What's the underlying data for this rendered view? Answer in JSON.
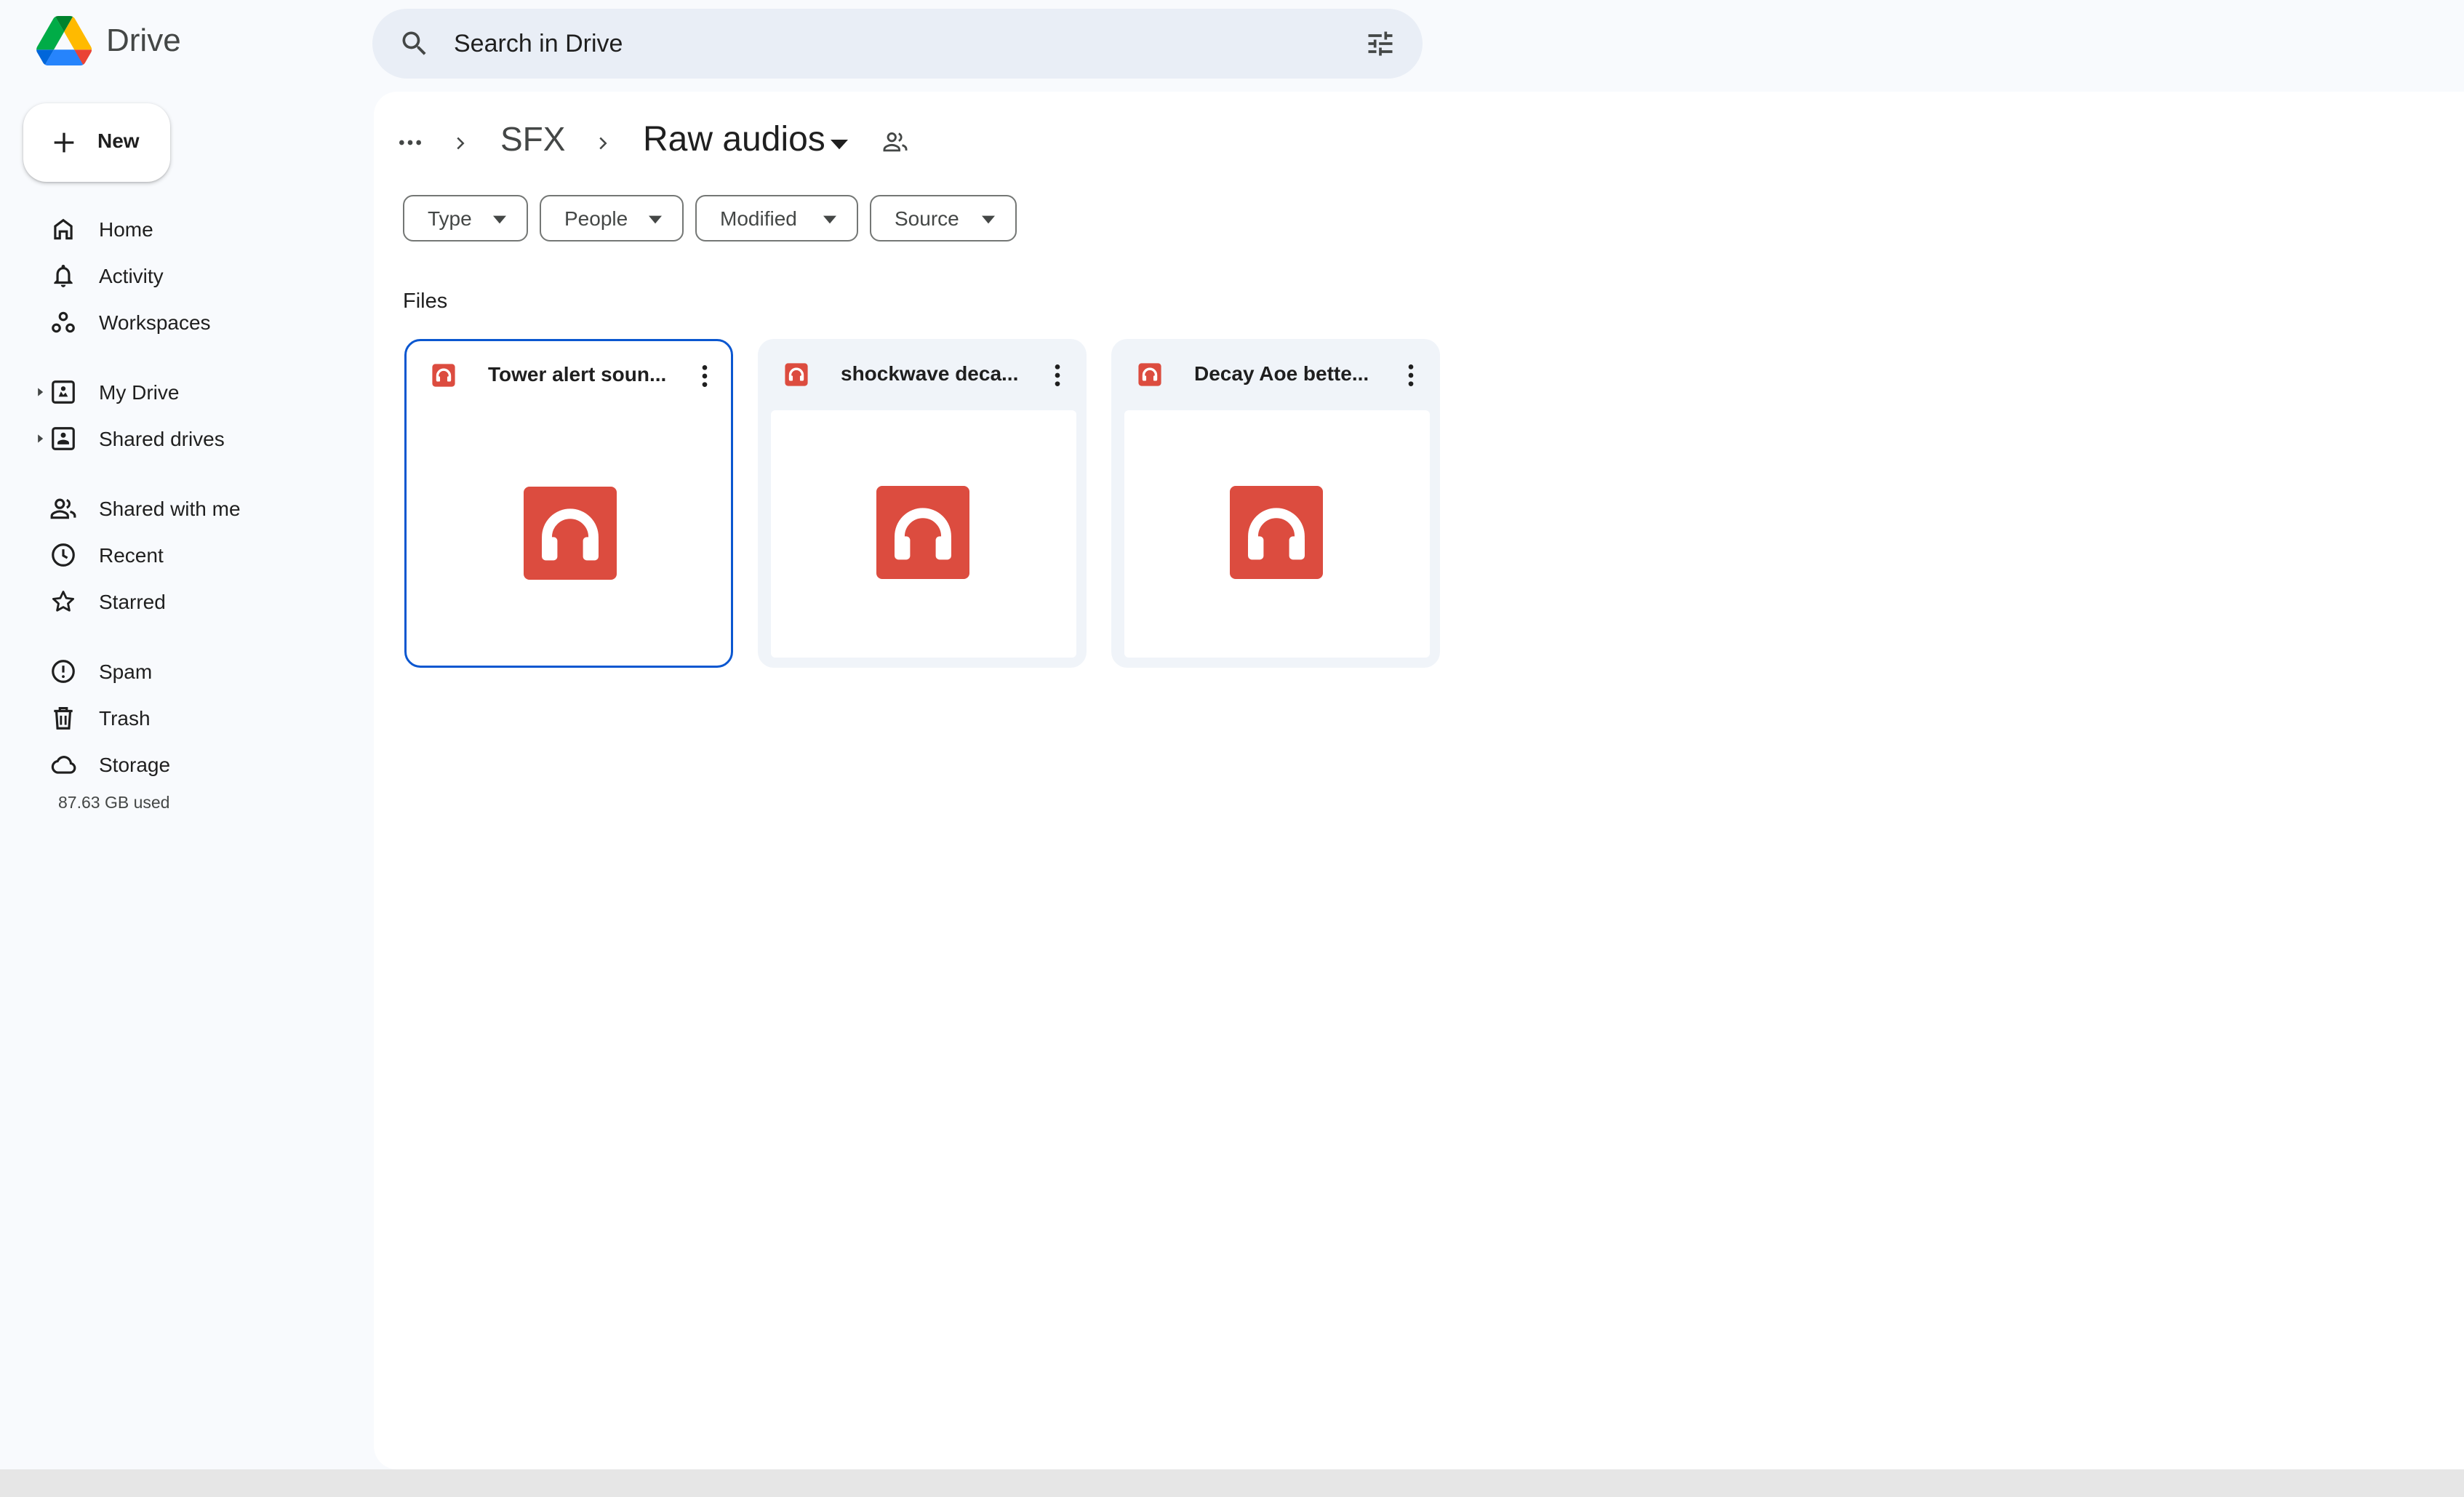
{
  "app": {
    "name": "Drive"
  },
  "search": {
    "placeholder": "Search in Drive"
  },
  "sidebar": {
    "new_label": "New",
    "items": [
      {
        "label": "Home",
        "icon": "home-icon"
      },
      {
        "label": "Activity",
        "icon": "bell-icon"
      },
      {
        "label": "Workspaces",
        "icon": "workspaces-icon"
      },
      {
        "label": "My Drive",
        "icon": "my-drive-icon"
      },
      {
        "label": "Shared drives",
        "icon": "shared-drives-icon"
      },
      {
        "label": "Shared with me",
        "icon": "people-icon"
      },
      {
        "label": "Recent",
        "icon": "clock-icon"
      },
      {
        "label": "Starred",
        "icon": "star-icon"
      },
      {
        "label": "Spam",
        "icon": "spam-icon"
      },
      {
        "label": "Trash",
        "icon": "trash-icon"
      },
      {
        "label": "Storage",
        "icon": "cloud-icon"
      }
    ],
    "storage_used": "87.63 GB used"
  },
  "breadcrumb": {
    "parent": "SFX",
    "current": "Raw audios"
  },
  "filters": [
    "Type",
    "People",
    "Modified",
    "Source"
  ],
  "files_heading": "Files",
  "files": [
    {
      "name": "Tower alert soun...",
      "type": "audio",
      "selected": true
    },
    {
      "name": "shockwave deca...",
      "type": "audio",
      "selected": false
    },
    {
      "name": "Decay Aoe bette...",
      "type": "audio",
      "selected": false
    }
  ],
  "colors": {
    "accent": "#0b57d0",
    "audio_icon": "#dc4c3f",
    "background": "#f8fafd"
  }
}
